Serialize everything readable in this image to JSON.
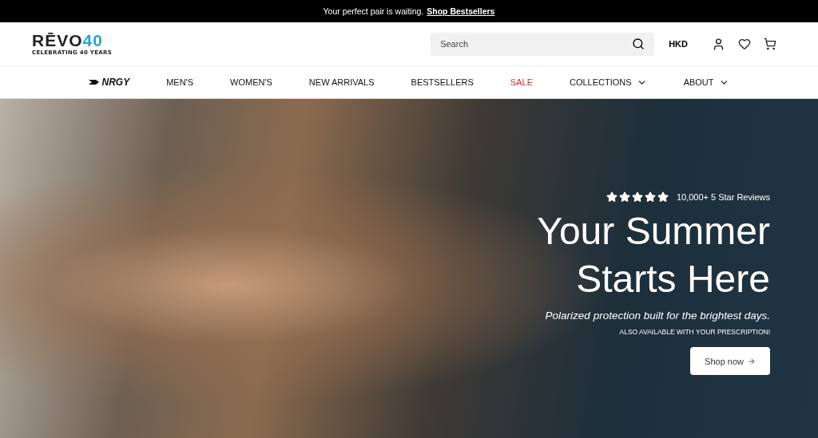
{
  "announcement": {
    "text": "Your perfect pair is waiting.",
    "link": "Shop Bestsellers"
  },
  "header": {
    "logo": {
      "brand": "RĒVO",
      "number": "40",
      "tagline": "CELEBRATING 40 YEARS"
    },
    "search": {
      "placeholder": "Search"
    },
    "currency": "HKD"
  },
  "nav": {
    "items": [
      {
        "label": "NRGY",
        "kind": "logo",
        "dropdown": false
      },
      {
        "label": "MEN'S",
        "kind": "link",
        "dropdown": false
      },
      {
        "label": "WOMEN'S",
        "kind": "link",
        "dropdown": false
      },
      {
        "label": "NEW ARRIVALS",
        "kind": "link",
        "dropdown": false
      },
      {
        "label": "BESTSELLERS",
        "kind": "link",
        "dropdown": false
      },
      {
        "label": "SALE",
        "kind": "sale",
        "dropdown": false
      },
      {
        "label": "COLLECTIONS",
        "kind": "link",
        "dropdown": true
      },
      {
        "label": "ABOUT",
        "kind": "link",
        "dropdown": true
      }
    ]
  },
  "hero": {
    "stars": 5,
    "reviews": "10,000+ 5 Star Reviews",
    "headline_lines": [
      "Your Summer",
      "Starts Here"
    ],
    "subtitle": "Polarized protection built for the brightest days.",
    "note": "ALSO AVAILABLE WITH YOUR PRESCRIPTION!",
    "button": "Shop now"
  }
}
